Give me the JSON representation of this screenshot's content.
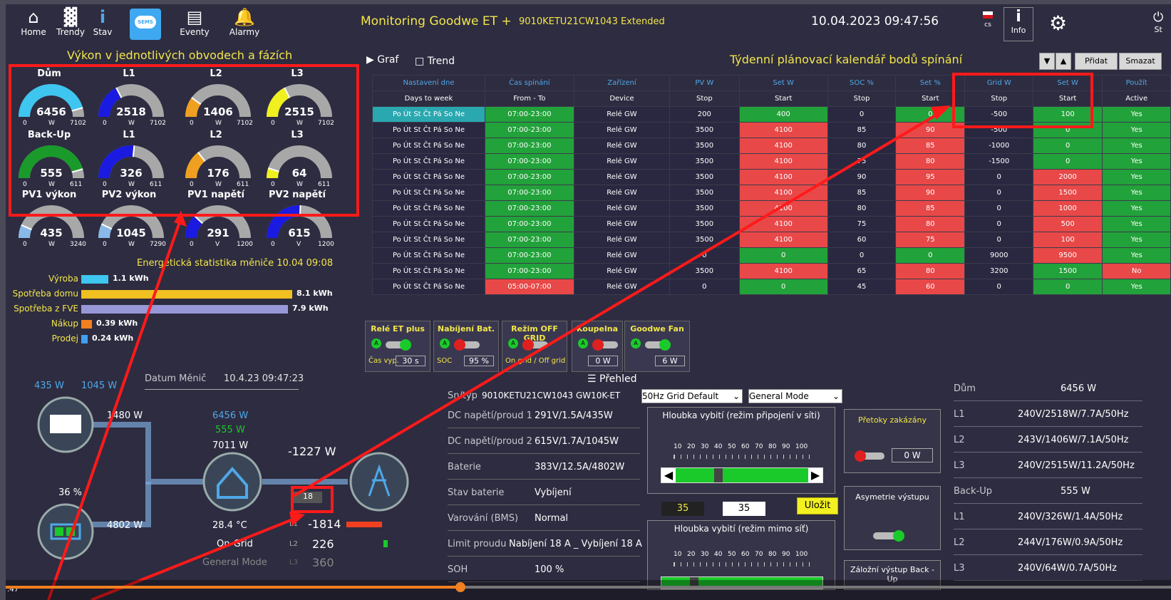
{
  "topbar": {
    "home": "Home",
    "trendy": "Trendy",
    "stav": "Stav",
    "sems": "SEMS",
    "eventy": "Eventy",
    "alarmy": "Alarmy",
    "title": "Monitoring Goodwe ET +",
    "subtitle": "9010KETU21CW1043 Extended",
    "datetime": "10.04.2023 09:47:56",
    "lang": "cs",
    "info": "Info",
    "stop": "St"
  },
  "left": {
    "heading": "Výkon v jednotlivých obvodech a fázích",
    "gauges_row1": [
      {
        "label": "Dům",
        "value": "6456",
        "min": "0",
        "unit": "W",
        "max": "7102",
        "color": "#3ec5f0",
        "fill": 0.91
      },
      {
        "label": "L1",
        "value": "2518",
        "min": "0",
        "unit": "W",
        "max": "7102",
        "color": "#1a1ae0",
        "fill": 0.35
      },
      {
        "label": "L2",
        "value": "1406",
        "min": "0",
        "unit": "W",
        "max": "7102",
        "color": "#f0a020",
        "fill": 0.2
      },
      {
        "label": "L3",
        "value": "2515",
        "min": "0",
        "unit": "W",
        "max": "7102",
        "color": "#f0f020",
        "fill": 0.35
      }
    ],
    "gauges_row2": [
      {
        "label": "Back-Up",
        "value": "555",
        "min": "0",
        "unit": "W",
        "max": "611",
        "color": "#1a9a2a",
        "fill": 0.91
      },
      {
        "label": "L1",
        "value": "326",
        "min": "0",
        "unit": "W",
        "max": "611",
        "color": "#1a1ae0",
        "fill": 0.53
      },
      {
        "label": "L2",
        "value": "176",
        "min": "0",
        "unit": "W",
        "max": "611",
        "color": "#f0a020",
        "fill": 0.29
      },
      {
        "label": "L3",
        "value": "64",
        "min": "0",
        "unit": "W",
        "max": "611",
        "color": "#f0f020",
        "fill": 0.1
      }
    ],
    "gauges_row3": [
      {
        "label": "PV1 výkon",
        "value": "435",
        "min": "0",
        "unit": "W",
        "max": "3240",
        "color": "#8ab8e8",
        "fill": 0.13
      },
      {
        "label": "PV2 výkon",
        "value": "1045",
        "min": "0",
        "unit": "W",
        "max": "7290",
        "color": "#8ab8e8",
        "fill": 0.14
      },
      {
        "label": "PV1 napětí",
        "value": "291",
        "min": "0",
        "unit": "V",
        "max": "1200",
        "color": "#1a1ae0",
        "fill": 0.24
      },
      {
        "label": "PV2 napětí",
        "value": "615",
        "min": "0",
        "unit": "V",
        "max": "1200",
        "color": "#1a1ae0",
        "fill": 0.51
      }
    ],
    "energy_title": "Energetická statistika měniče  10.04 09:08",
    "energy": [
      {
        "label": "Výroba",
        "value": "1.1 kWh",
        "color": "#3ec5f0",
        "frac": 0.13
      },
      {
        "label": "Spotřeba domu",
        "value": "8.1 kWh",
        "color": "#f0c020",
        "frac": 1.0
      },
      {
        "label": "Spotřeba z FVE",
        "value": "7.9 kWh",
        "color": "#9898d8",
        "frac": 0.98
      },
      {
        "label": "Nákup",
        "value": "0.39 kWh",
        "color": "#f08020",
        "frac": 0.05
      },
      {
        "label": "Prodej",
        "value": "0.24 kWh",
        "color": "#3ea0f0",
        "frac": 0.03
      }
    ]
  },
  "flow": {
    "pv1": "435 W",
    "pv2": "1045 W",
    "datum_label": "Datum Měnič",
    "datum_value": "10.4.23 09:47:23",
    "pv_total": "1480 W",
    "house1": "6456 W",
    "house2": "555 W",
    "house3": "7011 W",
    "grid_power": "-1227 W",
    "grid_box": "18",
    "soc": "36 %",
    "battery_w": "4802 W",
    "temp": "28.4 °C",
    "ongrid": "On-Grid",
    "mode": "General Mode",
    "l1_lbl": "L1",
    "l1": "-1814",
    "l2_lbl": "L2",
    "l2": "226",
    "l3_lbl": "L3",
    "l3": "360"
  },
  "schedule": {
    "graf": "Graf",
    "trend": "Trend",
    "title": "Týdenní plánovací kalendář bodů spínání",
    "pridat": "Přidat",
    "smazat": "Smazat",
    "headers1": [
      "Nastavení dne",
      "Čas spínání",
      "Zařízení",
      "PV W",
      "Set W",
      "SOC %",
      "Set %",
      "Grid W",
      "Set W",
      "Použít"
    ],
    "headers2": [
      "Days to week",
      "From - To",
      "Device",
      "Stop",
      "Start",
      "Stop",
      "Start",
      "Stop",
      "Start",
      "Active"
    ],
    "rows": [
      [
        "Po Út St Čt Pá So Ne",
        "07:00-23:00",
        "Relé GW",
        "200",
        "400",
        "0",
        "0",
        "-500",
        "100",
        "Yes"
      ],
      [
        "Po Út St Čt Pá So Ne",
        "07:00-23:00",
        "Relé GW",
        "3500",
        "4100",
        "85",
        "90",
        "-500",
        "0",
        "Yes"
      ],
      [
        "Po Út St Čt Pá So Ne",
        "07:00-23:00",
        "Relé GW",
        "3500",
        "4100",
        "80",
        "85",
        "-1000",
        "0",
        "Yes"
      ],
      [
        "Po Út St Čt Pá So Ne",
        "07:00-23:00",
        "Relé GW",
        "3500",
        "4100",
        "75",
        "80",
        "-1500",
        "0",
        "Yes"
      ],
      [
        "Po Út St Čt Pá So Ne",
        "07:00-23:00",
        "Relé GW",
        "3500",
        "4100",
        "90",
        "95",
        "0",
        "2000",
        "Yes"
      ],
      [
        "Po Út St Čt Pá So Ne",
        "07:00-23:00",
        "Relé GW",
        "3500",
        "4100",
        "85",
        "90",
        "0",
        "1500",
        "Yes"
      ],
      [
        "Po Út St Čt Pá So Ne",
        "07:00-23:00",
        "Relé GW",
        "3500",
        "4100",
        "80",
        "85",
        "0",
        "1000",
        "Yes"
      ],
      [
        "Po Út St Čt Pá So Ne",
        "07:00-23:00",
        "Relé GW",
        "3500",
        "4100",
        "75",
        "80",
        "0",
        "500",
        "Yes"
      ],
      [
        "Po Út St Čt Pá So Ne",
        "07:00-23:00",
        "Relé GW",
        "3500",
        "4100",
        "60",
        "75",
        "0",
        "100",
        "Yes"
      ],
      [
        "Po Út St Čt Pá So Ne",
        "07:00-23:00",
        "Relé GW",
        "0",
        "0",
        "0",
        "0",
        "9000",
        "9500",
        "Yes"
      ],
      [
        "Po Út St Čt Pá So Ne",
        "07:00-23:00",
        "Relé GW",
        "3500",
        "4100",
        "65",
        "80",
        "3200",
        "1500",
        "No"
      ],
      [
        "Po Út St Čt Pá So Ne",
        "05:00-07:00",
        "Relé GW",
        "0",
        "0",
        "45",
        "60",
        "0",
        "0",
        "Yes"
      ]
    ],
    "row_colors": [
      [
        "cyan",
        "g",
        "dk",
        "dk",
        "g",
        "dk",
        "g",
        "dk",
        "g",
        "g"
      ],
      [
        "dk",
        "g",
        "dk",
        "dk",
        "r",
        "dk",
        "r",
        "dk",
        "g",
        "g"
      ],
      [
        "dk",
        "g",
        "dk",
        "dk",
        "r",
        "dk",
        "r",
        "dk",
        "g",
        "g"
      ],
      [
        "dk",
        "g",
        "dk",
        "dk",
        "r",
        "dk",
        "r",
        "dk",
        "g",
        "g"
      ],
      [
        "dk",
        "g",
        "dk",
        "dk",
        "r",
        "dk",
        "r",
        "dk",
        "r",
        "g"
      ],
      [
        "dk",
        "g",
        "dk",
        "dk",
        "r",
        "dk",
        "r",
        "dk",
        "r",
        "g"
      ],
      [
        "dk",
        "g",
        "dk",
        "dk",
        "r",
        "dk",
        "r",
        "dk",
        "r",
        "g"
      ],
      [
        "dk",
        "g",
        "dk",
        "dk",
        "r",
        "dk",
        "r",
        "dk",
        "r",
        "g"
      ],
      [
        "dk",
        "g",
        "dk",
        "dk",
        "r",
        "dk",
        "r",
        "dk",
        "r",
        "g"
      ],
      [
        "dk",
        "g",
        "dk",
        "dk",
        "g",
        "dk",
        "g",
        "dk",
        "r",
        "g"
      ],
      [
        "dk",
        "g",
        "dk",
        "dk",
        "r",
        "dk",
        "r",
        "dk",
        "g",
        "r"
      ],
      [
        "dk",
        "r",
        "dk",
        "dk",
        "g",
        "dk",
        "r",
        "dk",
        "g",
        "g"
      ]
    ]
  },
  "relays": [
    {
      "title": "Relé ET plus",
      "foot_label": "Čas vyp.",
      "foot_value": "30 s",
      "state": "green"
    },
    {
      "title": "Nabíjení Bat.",
      "foot_label": "SOC",
      "foot_value": "95 %",
      "state": "red"
    },
    {
      "title": "Režim OFF GRID",
      "foot_label": "On grid / Off grid",
      "foot_value": "",
      "state": "red"
    },
    {
      "title": "Koupelna",
      "foot_label": "",
      "foot_value": "0 W",
      "state": "red"
    },
    {
      "title": "Goodwe Fan",
      "foot_label": "",
      "foot_value": "6 W",
      "state": "green"
    }
  ],
  "overview": {
    "title": "Přehled",
    "sn_label": "Sn/typ",
    "sn_value": "9010KETU21CW1043 GW10K-ET",
    "grid_select": "50Hz Grid Default",
    "mode_select": "General Mode",
    "rows": [
      {
        "label": "DC napětí/proud 1",
        "value": "291V/1.5A/435W"
      },
      {
        "label": "DC napětí/proud 2",
        "value": "615V/1.7A/1045W"
      },
      {
        "label": "Baterie",
        "value": "383V/12.5A/4802W"
      },
      {
        "label": "Stav baterie",
        "value": "Vybíjení"
      },
      {
        "label": "Varování (BMS)",
        "value": "Normal"
      },
      {
        "label": "Limit proudu",
        "value": "Nabíjení 18 A _ Vybíjení 18 A"
      },
      {
        "label": "SOH",
        "value": "100 %"
      }
    ],
    "depth_title1": "Hloubka vybití (režim připojení v síti)",
    "depth_title2": "Hloubka  vybití  (režim mimo síť)",
    "ticks": [
      "10",
      "20",
      "30",
      "40",
      "50",
      "60",
      "70",
      "80",
      "90",
      "100"
    ],
    "depth_val1": "35",
    "depth_val2": "35",
    "save": "Uložit",
    "pretoky": "Přetoky zakázány",
    "pretoky_w": "0 W",
    "asym": "Asymetrie výstupu",
    "zalozni": "Záložní výstup Back - Up"
  },
  "right": [
    {
      "label": "Dům",
      "value": "6456 W"
    },
    {
      "label": "L1",
      "value": "240V/2518W/7.7A/50Hz"
    },
    {
      "label": "L2",
      "value": "243V/1406W/7.1A/50Hz"
    },
    {
      "label": "L3",
      "value": "240V/2515W/11.2A/50Hz"
    },
    {
      "label": "Back-Up",
      "value": "555 W"
    },
    {
      "label": "L1",
      "value": "240V/326W/1.4A/50Hz"
    },
    {
      "label": "L2",
      "value": "244V/176W/0.9A/50Hz"
    },
    {
      "label": "L3",
      "value": "240V/64W/0.7A/50Hz"
    }
  ],
  "video": {
    "time": ":47",
    "progress": 0.39
  }
}
